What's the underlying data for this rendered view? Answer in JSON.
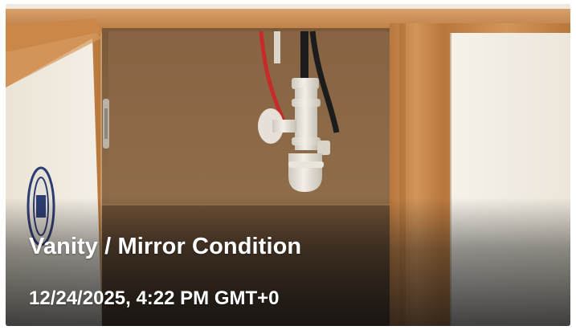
{
  "card": {
    "title": "Vanity / Mirror Condition",
    "timestamp": "12/24/2025, 4:22 PM GMT+0"
  },
  "photo": {
    "icons": [
      "cabinet-interior-photo",
      "drain-pipe",
      "water-supply-hoses",
      "cabinet-door-left",
      "cabinet-door-right",
      "round-sticker",
      "door-hinge"
    ]
  },
  "colors": {
    "wood_trim": "#c8884a",
    "cabinet_interior": "#8a6a4a",
    "door_panel": "#f1ece3",
    "pipe": "#e9e4dc",
    "hose_red": "#c62a2a",
    "hose_black": "#1c1c1c",
    "caption_text": "#ffffff"
  }
}
